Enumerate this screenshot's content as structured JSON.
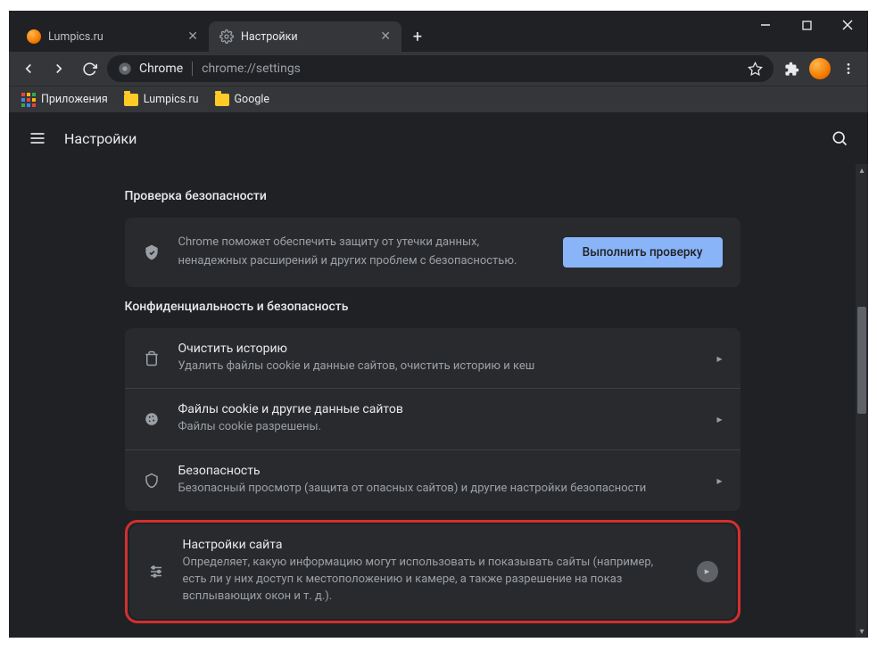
{
  "window": {
    "tabs": [
      {
        "title": "Lumpics.ru",
        "active": false
      },
      {
        "title": "Настройки",
        "active": true
      }
    ],
    "url_label": "Chrome",
    "url_path": "chrome://settings"
  },
  "bookmarks": [
    {
      "label": "Приложения",
      "type": "apps"
    },
    {
      "label": "Lumpics.ru",
      "type": "folder"
    },
    {
      "label": "Google",
      "type": "folder"
    }
  ],
  "appbar": {
    "title": "Настройки"
  },
  "safety_check": {
    "section_title": "Проверка безопасности",
    "text": "Chrome поможет обеспечить защиту от утечки данных, ненадежных расширений и других проблем с безопасностью.",
    "button": "Выполнить проверку"
  },
  "privacy": {
    "section_title": "Конфиденциальность и безопасность",
    "rows": [
      {
        "icon": "trash",
        "title": "Очистить историю",
        "sub": "Удалить файлы cookie и данные сайтов, очистить историю и кеш"
      },
      {
        "icon": "cookie",
        "title": "Файлы cookie и другие данные сайтов",
        "sub": "Файлы cookie разрешены."
      },
      {
        "icon": "shield",
        "title": "Безопасность",
        "sub": "Безопасный просмотр (защита от опасных сайтов) и другие настройки безопасности"
      }
    ],
    "highlighted": {
      "icon": "sliders",
      "title": "Настройки сайта",
      "sub": "Определяет, какую информацию могут использовать и показывать сайты (например, есть ли у них доступ к местоположению и камере, а также разрешение на показ всплывающих окон и т. д.)."
    }
  }
}
